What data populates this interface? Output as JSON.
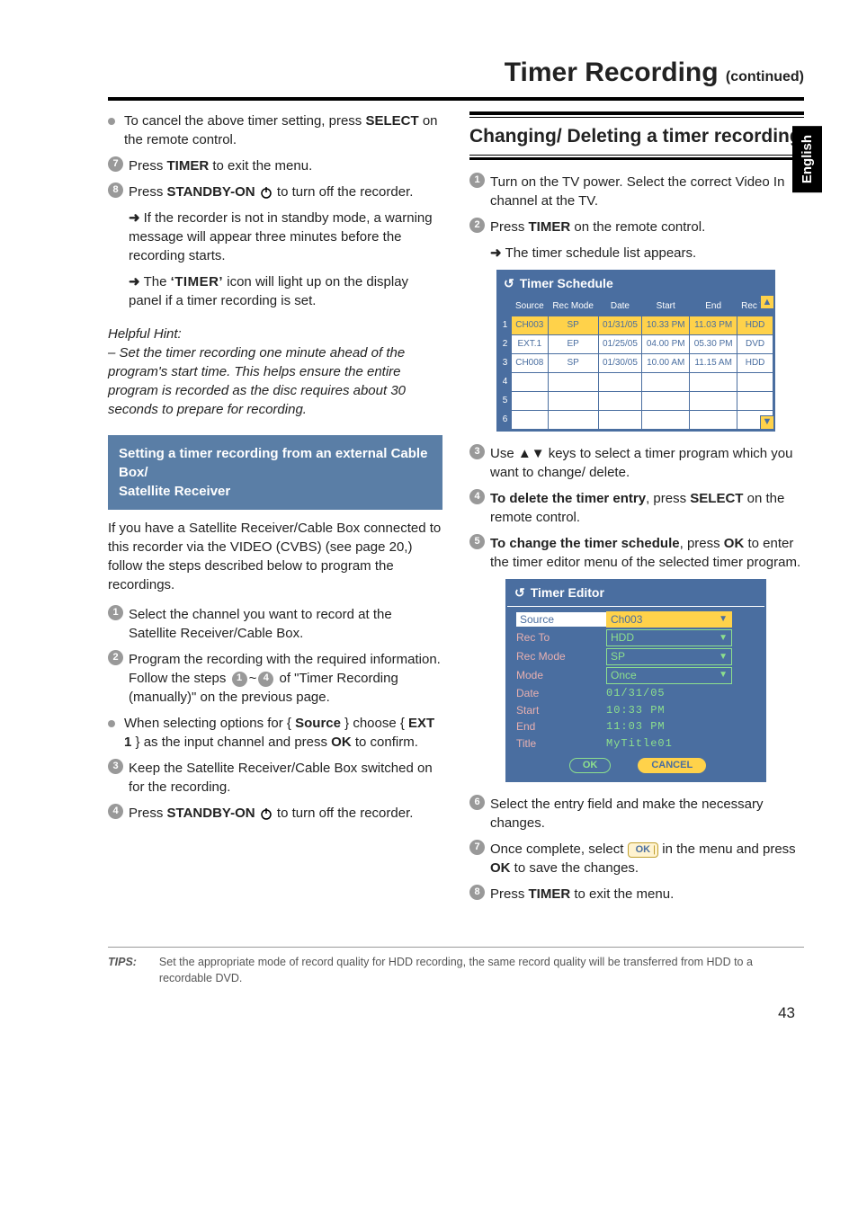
{
  "header": {
    "title": "Timer Recording",
    "continued": "(continued)"
  },
  "sideTab": "English",
  "left": {
    "cancelLine": {
      "pre": "To cancel the above timer setting, press ",
      "b1": "SELECT",
      "post": " on the remote control."
    },
    "step7": {
      "pre": "Press ",
      "b1": "TIMER",
      "post": " to exit the menu."
    },
    "step8": {
      "pre": "Press ",
      "b1": "STANDBY-ON",
      "post": " to turn off the recorder."
    },
    "sub1": "If the recorder is not in standby mode, a warning message will appear three minutes before the recording starts.",
    "sub2a": "The ",
    "sub2b": "‘TIMER’",
    "sub2c": " icon will light up on the display panel if a timer recording is set.",
    "hintTitle": "Helpful Hint:",
    "hintBody": "– Set the timer recording one minute ahead of the program's start time. This helps ensure the entire program is recorded as the disc requires about 30 seconds to prepare for recording.",
    "blueBox": "Setting a timer recording from an external Cable Box/\nSatellite Receiver",
    "para1": "If you have a Satellite Receiver/Cable Box connected to this recorder via the VIDEO (CVBS) (see page 20,) follow the steps described below to program the recordings.",
    "bstep1": "Select the channel you want to record at the Satellite Receiver/Cable Box.",
    "bstep2a": "Program the recording with the required information. Follow the steps ",
    "bstep2b": " of \"Timer Recording (manually)\" on the previous page.",
    "bbullet": {
      "pre": "When selecting options for { ",
      "b1": "Source",
      "mid": " } choose { ",
      "b2": "EXT 1",
      "post": " } as the input channel and press ",
      "b3": "OK",
      "end": " to confirm."
    },
    "bstep3": "Keep the Satellite Receiver/Cable Box switched on for the recording.",
    "bstep4": {
      "pre": "Press ",
      "b1": "STANDBY-ON",
      "post": " to turn off the recorder."
    }
  },
  "right": {
    "sectionTitle": "Changing/ Deleting a timer recording",
    "r1": "Turn on the TV power. Select the correct Video In channel at the TV.",
    "r2": {
      "pre": "Press ",
      "b1": "TIMER",
      "post": " on the remote control."
    },
    "r2sub": "The timer schedule list appears.",
    "schedule": {
      "title": "Timer Schedule",
      "headers": [
        "",
        "Source",
        "Rec Mode",
        "Date",
        "Start",
        "End",
        "Rec To"
      ],
      "rows": [
        {
          "idx": "1",
          "src": "CH003",
          "mode": "SP",
          "date": "01/31/05",
          "start": "10.33 PM",
          "end": "11.03 PM",
          "to": "HDD",
          "hl": true
        },
        {
          "idx": "2",
          "src": "EXT.1",
          "mode": "EP",
          "date": "01/25/05",
          "start": "04.00 PM",
          "end": "05.30 PM",
          "to": "DVD",
          "hl": false
        },
        {
          "idx": "3",
          "src": "CH008",
          "mode": "SP",
          "date": "01/30/05",
          "start": "10.00 AM",
          "end": "11.15 AM",
          "to": "HDD",
          "hl": false
        },
        {
          "idx": "4",
          "src": "",
          "mode": "",
          "date": "",
          "start": "",
          "end": "",
          "to": "",
          "hl": false
        },
        {
          "idx": "5",
          "src": "",
          "mode": "",
          "date": "",
          "start": "",
          "end": "",
          "to": "",
          "hl": false
        },
        {
          "idx": "6",
          "src": "",
          "mode": "",
          "date": "",
          "start": "",
          "end": "",
          "to": "",
          "hl": false
        }
      ]
    },
    "r3": "Use ▲▼ keys to select a timer program which you want to change/ delete.",
    "r4": {
      "b1": "To delete the timer entry",
      "mid": ", press ",
      "b2": "SELECT",
      "post": " on the remote control."
    },
    "r5": {
      "b1": "To change the timer schedule",
      "mid": ", press ",
      "b2": "OK",
      "post": " to enter the timer editor menu of the selected timer program."
    },
    "editor": {
      "title": "Timer Editor",
      "rows": [
        {
          "lbl": "Source",
          "val": "Ch003",
          "box": true,
          "hl": true
        },
        {
          "lbl": "Rec To",
          "val": "HDD",
          "box": true
        },
        {
          "lbl": "Rec Mode",
          "val": "SP",
          "box": true
        },
        {
          "lbl": "Mode",
          "val": "Once",
          "box": true
        },
        {
          "lbl": "Date",
          "val": "01/31/05"
        },
        {
          "lbl": "Start",
          "val": "10:33 PM"
        },
        {
          "lbl": "End",
          "val": "11:03 PM"
        },
        {
          "lbl": "Title",
          "val": "MyTitle01"
        }
      ],
      "ok": "OK",
      "cancel": "CANCEL"
    },
    "r6": "Select the entry field and make the necessary changes.",
    "r7a": "Once complete, select ",
    "r7ok": "OK",
    "r7b": " in the menu and press ",
    "r7c": "OK",
    "r7d": " to save the changes.",
    "r8": {
      "pre": "Press ",
      "b1": "TIMER",
      "post": " to exit the menu."
    }
  },
  "tips": {
    "label": "TIPS:",
    "text": "Set the appropriate mode of record quality for HDD recording, the same record quality will be transferred from HDD to a recordable DVD."
  },
  "pageNum": "43",
  "nums": {
    "1": "1",
    "2": "2",
    "3": "3",
    "4": "4",
    "5": "5",
    "6": "6",
    "7": "7",
    "8": "8",
    "tilde": "~"
  }
}
